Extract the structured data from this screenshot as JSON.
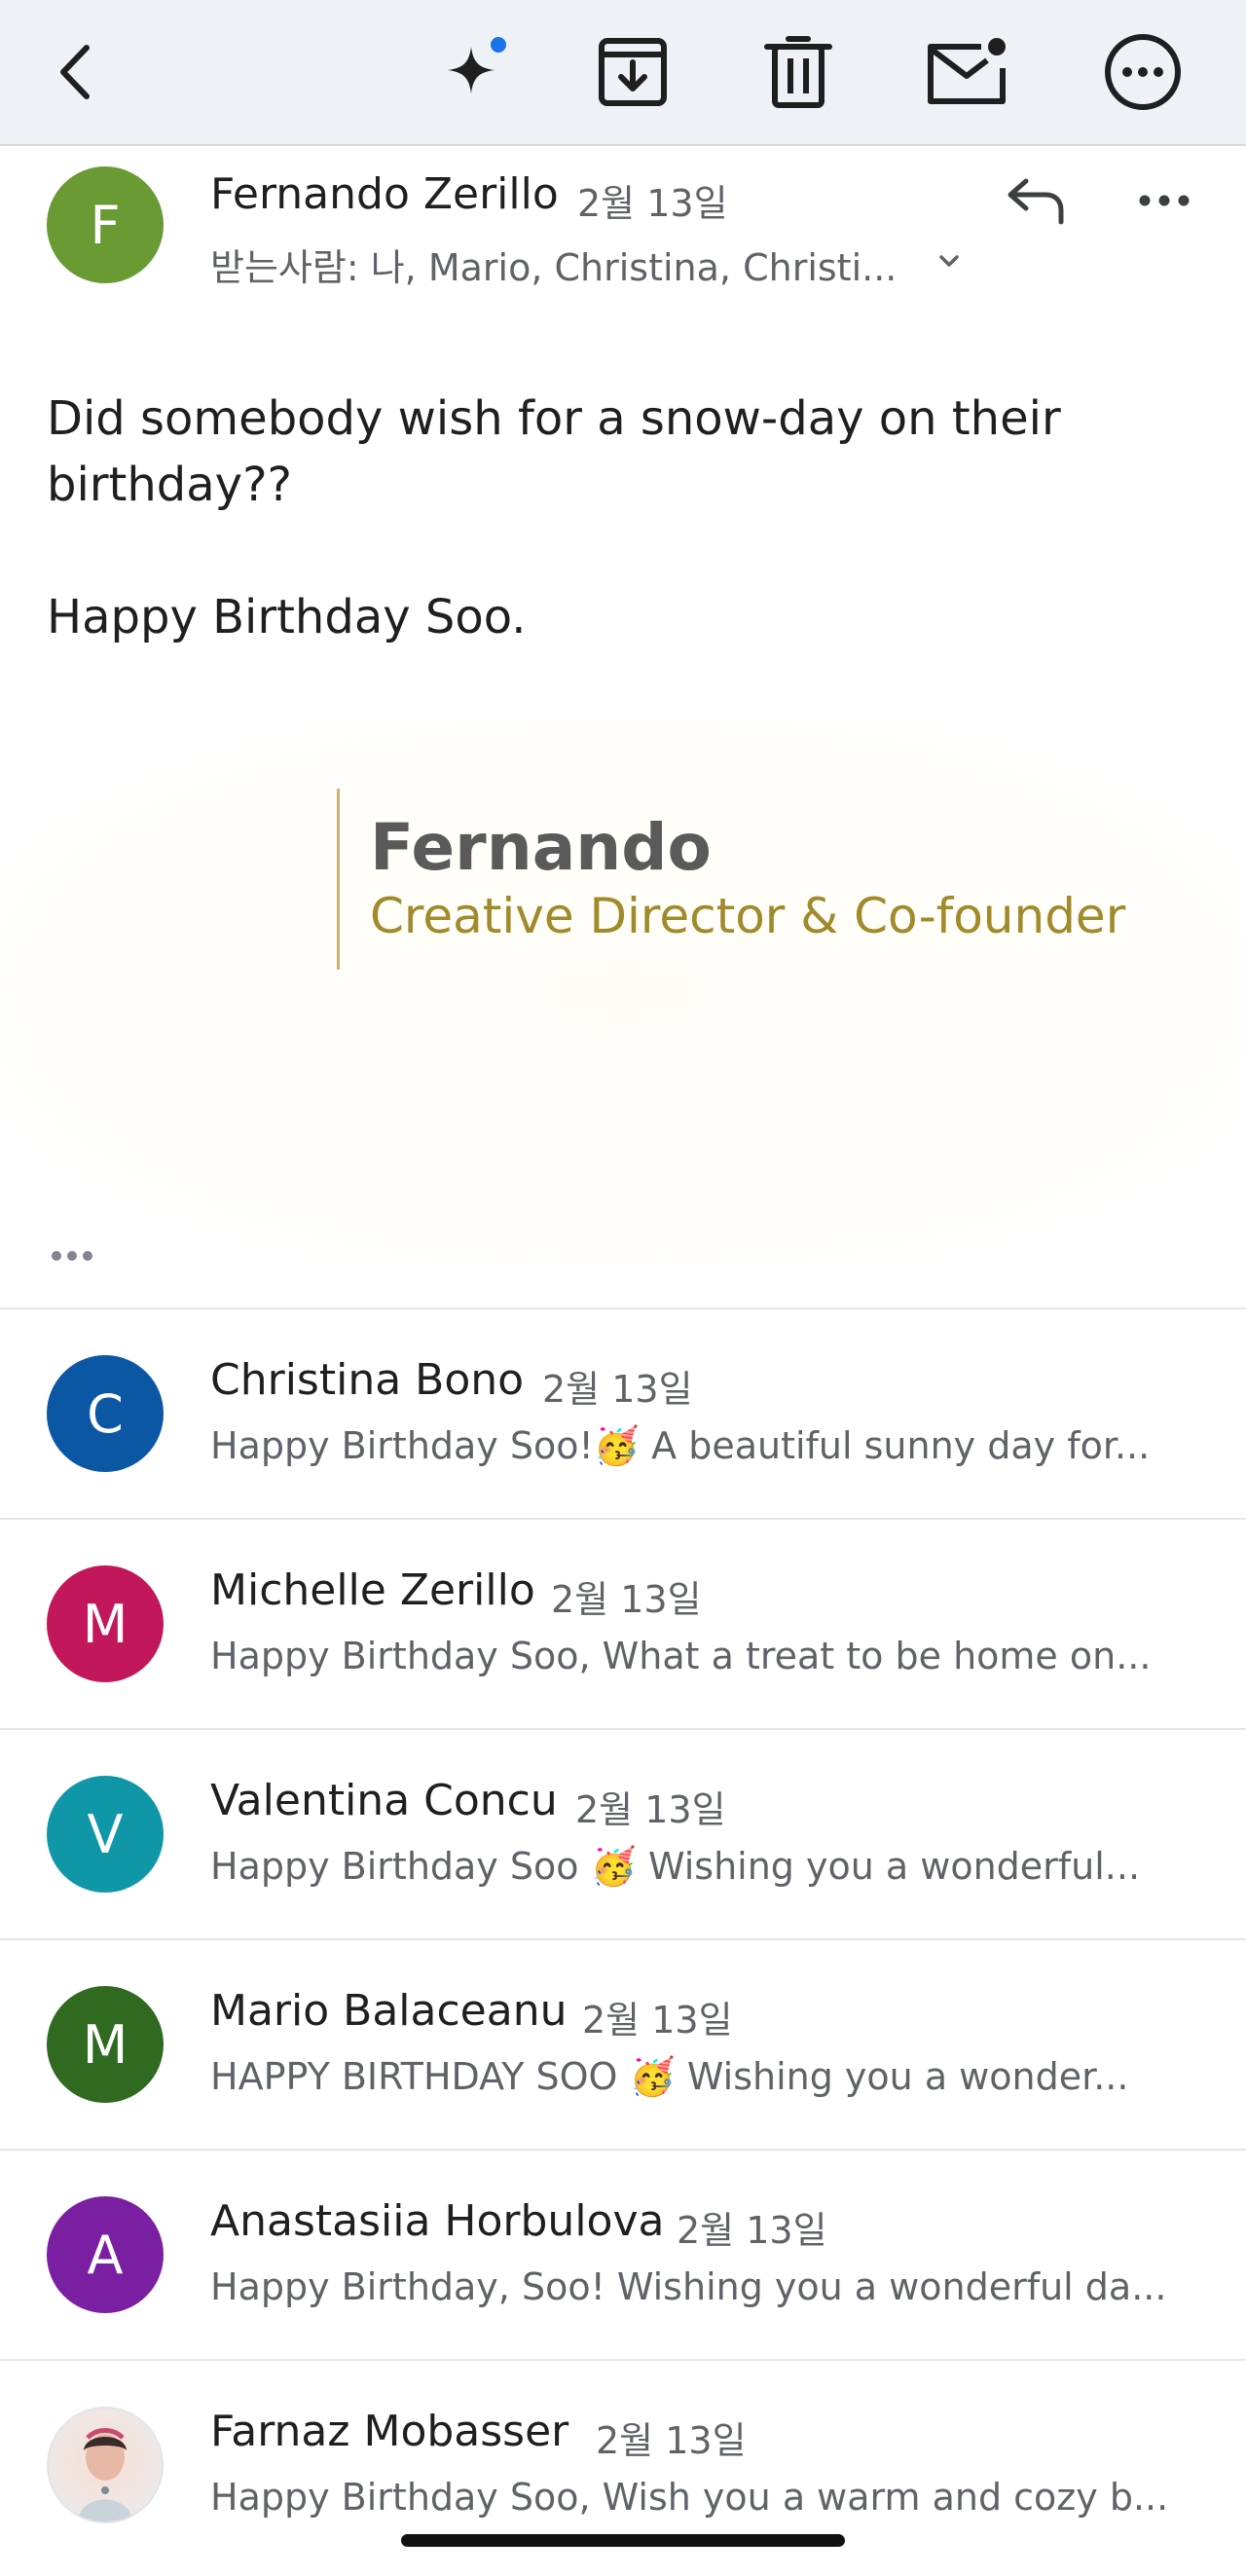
{
  "toolbar": {
    "back_icon": "chevron-left-icon",
    "ai_icon": "sparkle-icon",
    "archive_icon": "archive-download-icon",
    "delete_icon": "trash-icon",
    "unread_icon": "mail-unread-icon",
    "more_icon": "more-circle-icon",
    "accent_color": "#1a73e8"
  },
  "message": {
    "avatar_letter": "F",
    "avatar_color": "#6a9a33",
    "sender": "Fernando Zerillo",
    "date": "2월 13일",
    "recipients": "받는사람: 나, Mario, Christina, Christi...",
    "body": [
      "Did somebody wish for a snow-day on their birthday??",
      "Happy Birthday Soo."
    ],
    "signature": {
      "name": "Fernando",
      "title": "Creative Director & Co-founder"
    }
  },
  "thread": [
    {
      "avatar_letter": "C",
      "avatar_color": "#0b57a4",
      "sender": "Christina Bono",
      "date": "2월 13일",
      "snippet": "Happy Birthday Soo!🥳 A beautiful sunny day for..."
    },
    {
      "avatar_letter": "M",
      "avatar_color": "#c2185b",
      "sender": "Michelle Zerillo",
      "date": "2월 13일",
      "snippet": "Happy Birthday Soo, What a treat to be home on..."
    },
    {
      "avatar_letter": "V",
      "avatar_color": "#0f97a8",
      "sender": "Valentina Concu",
      "date": "2월 13일",
      "snippet": "Happy Birthday Soo 🥳 Wishing you a wonderful..."
    },
    {
      "avatar_letter": "M",
      "avatar_color": "#2f6a20",
      "sender": "Mario Balaceanu",
      "date": "2월 13일",
      "snippet": "HAPPY BIRTHDAY SOO 🥳 Wishing you a wonder..."
    },
    {
      "avatar_letter": "A",
      "avatar_color": "#7b1fa2",
      "sender": "Anastasiia Horbulova",
      "date": "2월 13일",
      "snippet": "Happy Birthday, Soo! Wishing you a wonderful da..."
    },
    {
      "avatar_letter": "",
      "avatar_color": "#f1e6e2",
      "sender": "Farnaz Mobasser",
      "date": "2월 13일",
      "snippet": "Happy Birthday Soo, Wish you a warm and cozy b..."
    }
  ]
}
